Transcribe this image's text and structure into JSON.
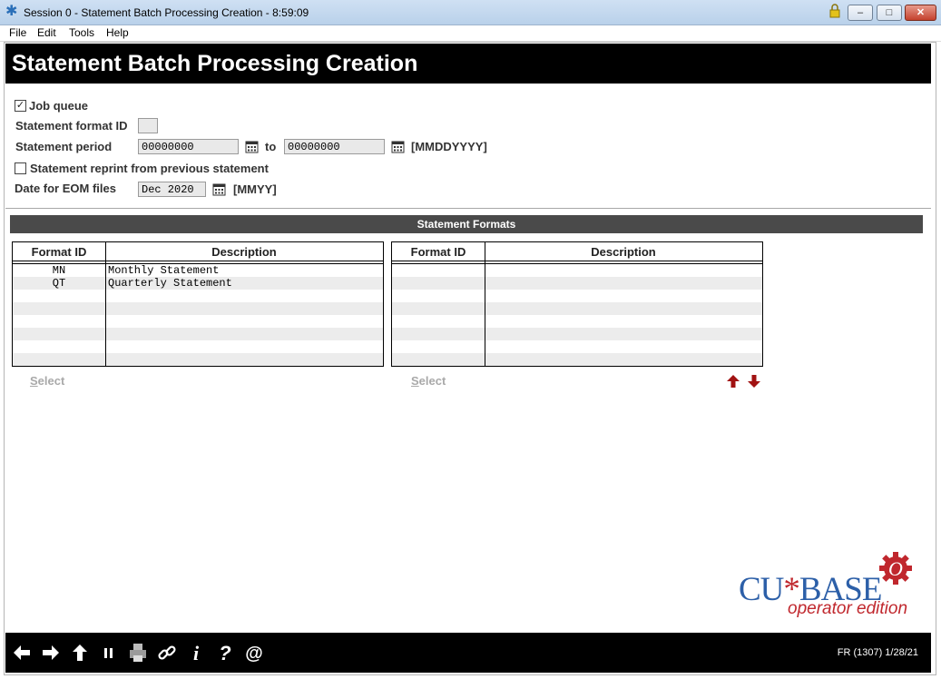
{
  "window": {
    "title": "Session 0  - Statement Batch Processing Creation - 8:59:09",
    "min_label": "–",
    "max_label": "□",
    "close_label": "✕"
  },
  "menu": {
    "items": [
      "File",
      "Edit",
      "Tools",
      "Help"
    ]
  },
  "header": {
    "title": "Statement Batch Processing Creation"
  },
  "form": {
    "job_queue": {
      "label": "Job queue",
      "checked": true
    },
    "format_id": {
      "label": "Statement format ID",
      "value": ""
    },
    "period": {
      "label": "Statement period",
      "from": "00000000",
      "to_label": "to",
      "to": "00000000",
      "hint": "[MMDDYYYY]"
    },
    "reprint": {
      "label": "Statement reprint from previous statement",
      "checked": false
    },
    "eom": {
      "label": "Date for EOM files",
      "value": "Dec 2020",
      "hint": "[MMYY]"
    }
  },
  "section": {
    "title": "Statement Formats"
  },
  "tables": {
    "left": {
      "headers": [
        "Format ID",
        "Description"
      ],
      "rows": [
        {
          "id": "MN",
          "desc": "Monthly Statement"
        },
        {
          "id": "QT",
          "desc": "Quarterly Statement"
        }
      ]
    },
    "right": {
      "headers": [
        "Format ID",
        "Description"
      ],
      "rows": []
    }
  },
  "actions": {
    "select_left": "Select",
    "select_right": "Select",
    "select_accel": "S"
  },
  "icons": [
    "back-arrow-icon",
    "forward-arrow-icon",
    "up-arrow-icon",
    "pause-icon",
    "print-icon",
    "link-icon",
    "info-icon",
    "help-icon",
    "at-icon"
  ],
  "status": {
    "text": "FR (1307) 1/28/21"
  },
  "logo": {
    "cu": "CU",
    "star": "*",
    "base": "BASE",
    "edition": "operator edition",
    "gear_letter": "O"
  },
  "colors": {
    "header_bg": "#000000",
    "section_bg": "#4a4a4a",
    "arrow_red": "#a11212",
    "logo_blue": "#2c5fa8",
    "logo_red": "#c0272d"
  }
}
